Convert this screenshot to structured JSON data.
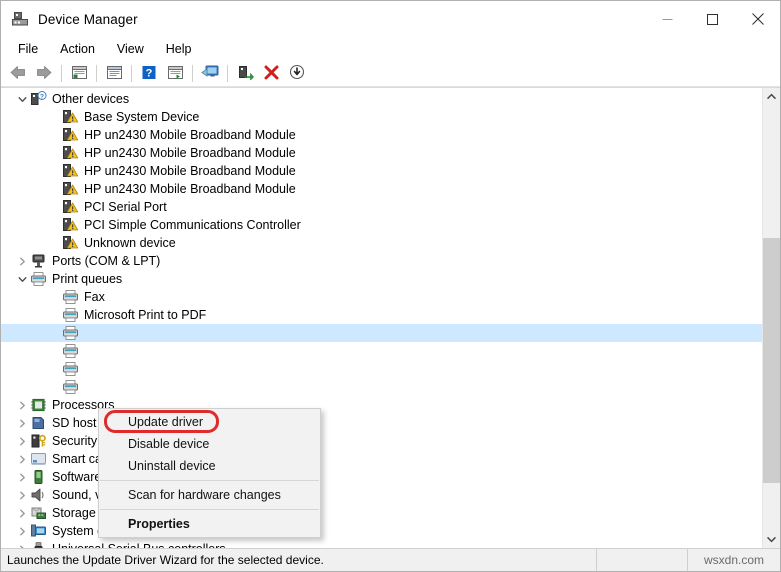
{
  "window": {
    "title": "Device Manager",
    "icon": "device-manager-icon",
    "controls": {
      "minimize": "minimize-icon",
      "maximize": "maximize-icon",
      "close": "close-icon"
    }
  },
  "menubar": {
    "items": [
      {
        "label": "File"
      },
      {
        "label": "Action"
      },
      {
        "label": "View"
      },
      {
        "label": "Help"
      }
    ]
  },
  "toolbar": {
    "buttons": [
      {
        "name": "back-button",
        "icon": "left-arrow-icon"
      },
      {
        "name": "forward-button",
        "icon": "right-arrow-icon"
      },
      {
        "name": "separator-1",
        "icon": "separator"
      },
      {
        "name": "show-hide-console-tree-button",
        "icon": "console-tree-icon"
      },
      {
        "name": "separator-2",
        "icon": "separator"
      },
      {
        "name": "properties-button",
        "icon": "properties-window-icon"
      },
      {
        "name": "separator-3",
        "icon": "separator"
      },
      {
        "name": "help-button",
        "icon": "question-mark-icon"
      },
      {
        "name": "scan-button",
        "icon": "scan-list-icon"
      },
      {
        "name": "separator-4",
        "icon": "separator"
      },
      {
        "name": "update-driver-button",
        "icon": "monitor-update-icon"
      },
      {
        "name": "separator-5",
        "icon": "separator"
      },
      {
        "name": "enable-device-button",
        "icon": "enable-device-icon"
      },
      {
        "name": "uninstall-device-button",
        "icon": "red-x-icon"
      },
      {
        "name": "scan-hardware-changes-button",
        "icon": "down-arrow-circle-icon"
      }
    ]
  },
  "tree": {
    "rows": [
      {
        "label": "Other devices",
        "level": 0,
        "expander": "expanded",
        "icon": "unknown-device-category-icon"
      },
      {
        "label": "Base System Device",
        "level": 1,
        "expander": "none",
        "icon": "warning-device-icon"
      },
      {
        "label": "HP un2430 Mobile Broadband Module",
        "level": 1,
        "expander": "none",
        "icon": "warning-device-icon"
      },
      {
        "label": "HP un2430 Mobile Broadband Module",
        "level": 1,
        "expander": "none",
        "icon": "warning-device-icon"
      },
      {
        "label": "HP un2430 Mobile Broadband Module",
        "level": 1,
        "expander": "none",
        "icon": "warning-device-icon"
      },
      {
        "label": "HP un2430 Mobile Broadband Module",
        "level": 1,
        "expander": "none",
        "icon": "warning-device-icon"
      },
      {
        "label": "PCI Serial Port",
        "level": 1,
        "expander": "none",
        "icon": "warning-device-icon"
      },
      {
        "label": "PCI Simple Communications Controller",
        "level": 1,
        "expander": "none",
        "icon": "warning-device-icon"
      },
      {
        "label": "Unknown device",
        "level": 1,
        "expander": "none",
        "icon": "warning-device-icon"
      },
      {
        "label": "Ports (COM & LPT)",
        "level": 0,
        "expander": "collapsed",
        "icon": "port-icon"
      },
      {
        "label": "Print queues",
        "level": 0,
        "expander": "expanded",
        "icon": "printer-icon"
      },
      {
        "label": "Fax",
        "level": 1,
        "expander": "none",
        "icon": "printer-icon"
      },
      {
        "label": "Microsoft Print to PDF",
        "level": 1,
        "expander": "none",
        "icon": "printer-icon"
      },
      {
        "label": "",
        "level": 1,
        "expander": "none",
        "icon": "printer-icon",
        "selected": true
      },
      {
        "label": "",
        "level": 1,
        "expander": "none",
        "icon": "printer-icon"
      },
      {
        "label": "",
        "level": 1,
        "expander": "none",
        "icon": "printer-icon"
      },
      {
        "label": "",
        "level": 1,
        "expander": "none",
        "icon": "printer-icon"
      },
      {
        "label": "Processors",
        "level": 0,
        "expander": "collapsed",
        "icon": "processor-icon"
      },
      {
        "label": "SD host adapters",
        "level": 0,
        "expander": "collapsed",
        "icon": "sd-host-icon"
      },
      {
        "label": "Security devices",
        "level": 0,
        "expander": "collapsed",
        "icon": "security-device-icon"
      },
      {
        "label": "Smart card readers",
        "level": 0,
        "expander": "collapsed",
        "icon": "smart-card-reader-icon"
      },
      {
        "label": "Software devices",
        "level": 0,
        "expander": "collapsed",
        "icon": "software-device-icon"
      },
      {
        "label": "Sound, video and game controllers",
        "level": 0,
        "expander": "collapsed",
        "icon": "speaker-icon"
      },
      {
        "label": "Storage controllers",
        "level": 0,
        "expander": "collapsed",
        "icon": "storage-controller-icon"
      },
      {
        "label": "System devices",
        "level": 0,
        "expander": "collapsed",
        "icon": "system-device-icon"
      },
      {
        "label": "Universal Serial Bus controllers",
        "level": 0,
        "expander": "collapsed",
        "icon": "usb-icon"
      }
    ]
  },
  "context_menu": {
    "items": [
      {
        "label": "Update driver",
        "type": "item",
        "highlighted": true
      },
      {
        "label": "Disable device",
        "type": "item"
      },
      {
        "label": "Uninstall device",
        "type": "item"
      },
      {
        "type": "separator"
      },
      {
        "label": "Scan for hardware changes",
        "type": "item"
      },
      {
        "type": "separator"
      },
      {
        "label": "Properties",
        "type": "item",
        "bold": true
      }
    ],
    "highlight_color": "#e02b2b"
  },
  "statusbar": {
    "text": "Launches the Update Driver Wizard for the selected device.",
    "watermark": "wsxdn.com"
  },
  "scrollbar": {
    "up_arrow": "chevron-up-icon",
    "down_arrow": "chevron-down-icon"
  }
}
